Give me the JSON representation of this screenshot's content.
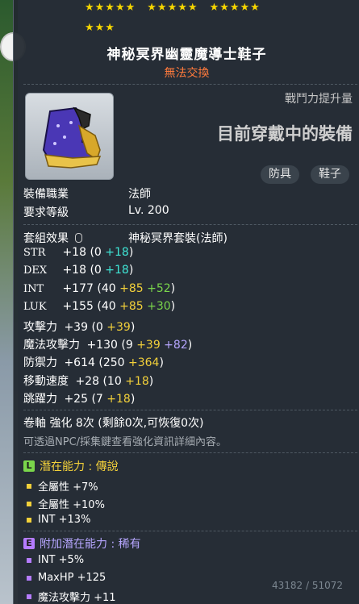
{
  "stars": {
    "row1": [
      "★★★★★",
      "★★★★★",
      "★★★★★"
    ],
    "row2": "★★★"
  },
  "item": {
    "name": "神秘冥界幽靈魔導士鞋子",
    "trade_restriction": "無法交換"
  },
  "panel": {
    "power_up_label": "戰鬥力提升量",
    "equipped_status": "目前穿戴中的裝備",
    "tags": [
      "防具",
      "鞋子"
    ]
  },
  "requirements": [
    {
      "label": "裝備職業",
      "value": "法師"
    },
    {
      "label": "要求等級",
      "value": "Lv. 200"
    }
  ],
  "set_effect": {
    "label": "套組效果",
    "value": "神秘冥界套裝(法師)"
  },
  "stats": [
    {
      "name": "STR",
      "total": "+18",
      "base": "(0",
      "p1": "+18",
      "p1_color": "cyan",
      "p2": "",
      "p2_color": "",
      "close": ")"
    },
    {
      "name": "DEX",
      "total": "+18",
      "base": "(0",
      "p1": "+18",
      "p1_color": "cyan",
      "p2": "",
      "p2_color": "",
      "close": ")"
    },
    {
      "name": "INT",
      "total": "+177",
      "base": "(40",
      "p1": "+85",
      "p1_color": "yellow",
      "p2": "+52",
      "p2_color": "green",
      "close": ")"
    },
    {
      "name": "LUK",
      "total": "+155",
      "base": "(40",
      "p1": "+85",
      "p1_color": "yellow",
      "p2": "+30",
      "p2_color": "green",
      "close": ")"
    },
    {
      "name": "攻擊力",
      "total": "+39",
      "base": "(0",
      "p1": "+39",
      "p1_color": "yellow",
      "p2": "",
      "p2_color": "",
      "close": ")"
    },
    {
      "name": "魔法攻擊力",
      "total": "+130",
      "base": "(9",
      "p1": "+39",
      "p1_color": "yellow",
      "p2": "+82",
      "p2_color": "purple",
      "close": ")"
    },
    {
      "name": "防禦力",
      "total": "+614",
      "base": "(250",
      "p1": "+364",
      "p1_color": "yellow",
      "p2": "",
      "p2_color": "",
      "close": ")"
    },
    {
      "name": "移動速度",
      "total": "+28",
      "base": "(10",
      "p1": "+18",
      "p1_color": "yellow",
      "p2": "",
      "p2_color": "",
      "close": ")"
    },
    {
      "name": "跳躍力",
      "total": "+25",
      "base": "(7",
      "p1": "+18",
      "p1_color": "yellow",
      "p2": "",
      "p2_color": "",
      "close": ")"
    }
  ],
  "scroll": {
    "text": "卷軸 強化 8次 (剩餘0次,可恢復0次)",
    "hint": "可透過NPC/採集鍵查看強化資訊詳細內容。"
  },
  "potential": {
    "title": "潛在能力 : 傳說",
    "badge": "L",
    "lines": [
      "全屬性 +7%",
      "全屬性 +10%",
      "INT +13%"
    ]
  },
  "additional_potential": {
    "title": "附加潛在能力 : 稀有",
    "badge": "E",
    "lines": [
      "INT +5%",
      "MaxHP +125",
      "魔法攻擊力 +11"
    ]
  },
  "background_readout": "43182 / 51072"
}
